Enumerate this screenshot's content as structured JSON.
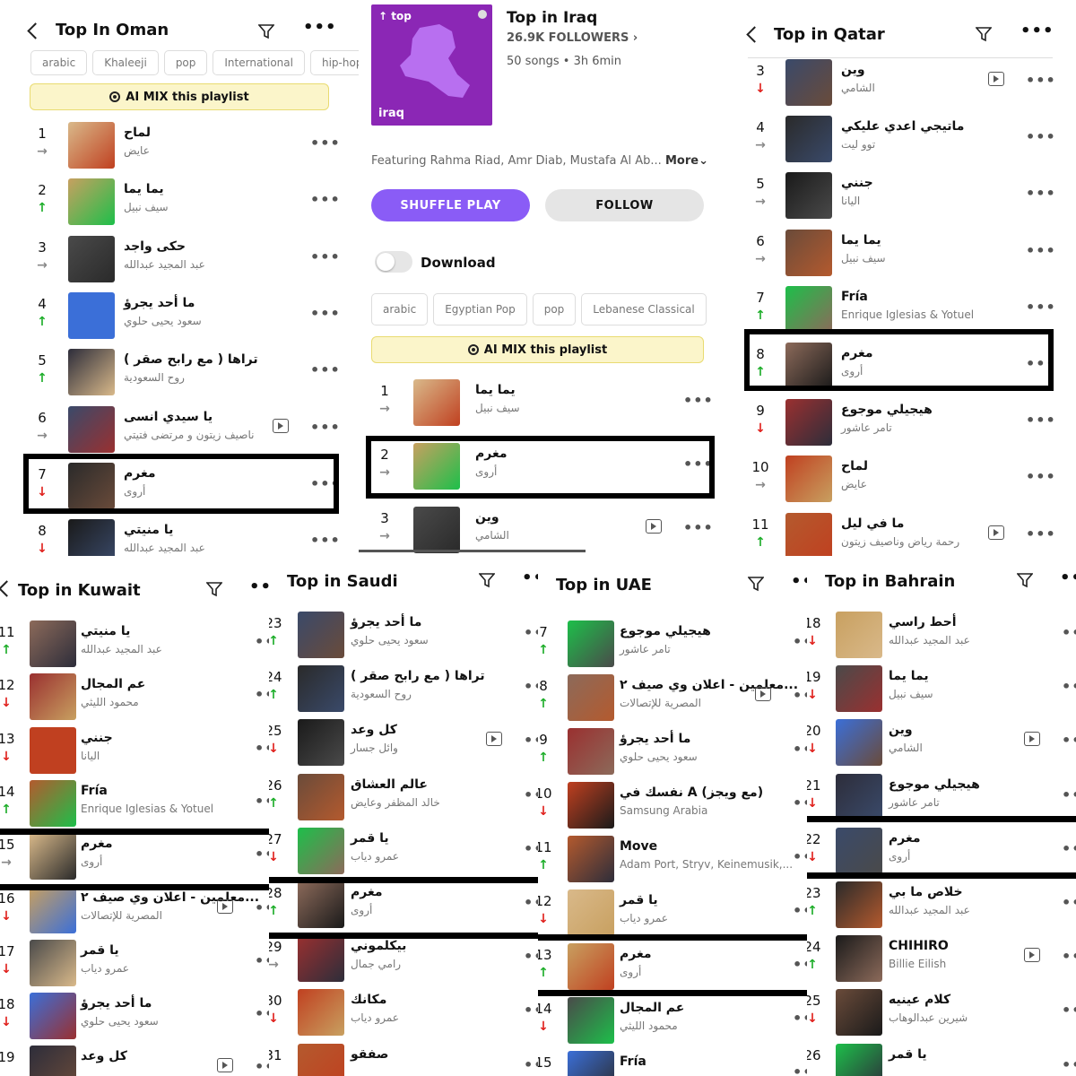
{
  "oman": {
    "title": "Top In Oman",
    "tags": [
      "arabic",
      "Khaleeji",
      "pop",
      "International",
      "hip-hop"
    ],
    "aimix": "AI MIX this playlist",
    "rows": [
      {
        "rank": "1",
        "arrow": "→",
        "t": "لماح",
        "a": "عايض"
      },
      {
        "rank": "2",
        "arrow": "↑",
        "t": "يما يما",
        "a": "سيف نبيل"
      },
      {
        "rank": "3",
        "arrow": "→",
        "t": "حكى واجد",
        "a": "عبد المجيد عبدالله"
      },
      {
        "rank": "4",
        "arrow": "↑",
        "t": "ما أحد يجرؤ",
        "a": "سعود يحيى حلوي"
      },
      {
        "rank": "5",
        "arrow": "↑",
        "t": "تراها ( مع رابح صقر )",
        "a": "روح السعودية"
      },
      {
        "rank": "6",
        "arrow": "→",
        "t": "يا سيدي انسى",
        "a": "ناصيف زيتون و مرتضى فتيتي"
      },
      {
        "rank": "7",
        "arrow": "↓",
        "t": "مغرم",
        "a": "أروى"
      },
      {
        "rank": "8",
        "arrow": "↓",
        "t": "يا منيتي",
        "a": "عبد المجيد عبدالله"
      }
    ]
  },
  "iraq": {
    "cover_brand": "top",
    "cover_label": "iraq",
    "title": "Top in Iraq",
    "followers": "26.9K FOLLOWERS",
    "meta": "50 songs • 3h 6min",
    "featuring": "Featuring Rahma Riad, Amr Diab, Mustafa Al Ab...",
    "more": "More",
    "shuffle": "SHUFFLE PLAY",
    "follow": "FOLLOW",
    "download": "Download",
    "tags": [
      "arabic",
      "Egyptian Pop",
      "pop",
      "Lebanese Classical"
    ],
    "aimix": "AI MIX this playlist",
    "rows": [
      {
        "rank": "1",
        "arrow": "→",
        "t": "يما يما",
        "a": "سيف نبيل"
      },
      {
        "rank": "2",
        "arrow": "→",
        "t": "مغرم",
        "a": "أروى"
      },
      {
        "rank": "3",
        "arrow": "→",
        "t": "وين",
        "a": "الشامي"
      }
    ]
  },
  "qatar": {
    "title": "Top in Qatar",
    "rows": [
      {
        "rank": "3",
        "arrow": "↓",
        "t": "وين",
        "a": "الشامي"
      },
      {
        "rank": "4",
        "arrow": "→",
        "t": "ماتيجي اعدي عليكي",
        "a": "توو ليت"
      },
      {
        "rank": "5",
        "arrow": "→",
        "t": "جنني",
        "a": "اليانا"
      },
      {
        "rank": "6",
        "arrow": "→",
        "t": "يما يما",
        "a": "سيف نبيل"
      },
      {
        "rank": "7",
        "arrow": "↑",
        "t": "Fría",
        "a": "Enrique Iglesias & Yotuel"
      },
      {
        "rank": "8",
        "arrow": "↑",
        "t": "مغرم",
        "a": "أروى"
      },
      {
        "rank": "9",
        "arrow": "↓",
        "t": "هيجيلي موجوع",
        "a": "تامر عاشور"
      },
      {
        "rank": "10",
        "arrow": "→",
        "t": "لماح",
        "a": "عايض"
      },
      {
        "rank": "11",
        "arrow": "↑",
        "t": "ما في ليل",
        "a": "رحمة رياض وناصيف زيتون"
      }
    ]
  },
  "kuwait": {
    "title": "Top in Kuwait",
    "rows": [
      {
        "rank": "11",
        "arrow": "↑",
        "t": "يا منيتي",
        "a": "عبد المجيد عبدالله"
      },
      {
        "rank": "12",
        "arrow": "↓",
        "t": "عم المجال",
        "a": "محمود الليثي"
      },
      {
        "rank": "13",
        "arrow": "↓",
        "t": "جنني",
        "a": "اليانا"
      },
      {
        "rank": "14",
        "arrow": "↑",
        "t": "Fría",
        "a": "Enrique Iglesias & Yotuel"
      },
      {
        "rank": "15",
        "arrow": "→",
        "t": "مغرم",
        "a": "أروى"
      },
      {
        "rank": "16",
        "arrow": "↓",
        "t": "معلمين - اعلان وي صيف ٢...",
        "a": "المصرية للإتصالات"
      },
      {
        "rank": "17",
        "arrow": "↓",
        "t": "يا قمر",
        "a": "عمرو دياب"
      },
      {
        "rank": "18",
        "arrow": "↓",
        "t": "ما أحد يجرؤ",
        "a": "سعود يحيى حلوي"
      },
      {
        "rank": "19",
        "arrow": "",
        "t": "كل وعد",
        "a": ""
      }
    ]
  },
  "saudi": {
    "title": "Top in Saudi",
    "rows": [
      {
        "rank": "23",
        "arrow": "↑",
        "t": "ما أحد يجرؤ",
        "a": "سعود يحيى حلوي"
      },
      {
        "rank": "24",
        "arrow": "↑",
        "t": "تراها ( مع رابح صقر )",
        "a": "روح السعودية"
      },
      {
        "rank": "25",
        "arrow": "↓",
        "t": "كل وعد",
        "a": "وائل جسار"
      },
      {
        "rank": "26",
        "arrow": "↑",
        "t": "عالم العشاق",
        "a": "خالد المظفر وعايض"
      },
      {
        "rank": "27",
        "arrow": "↓",
        "t": "يا قمر",
        "a": "عمرو دياب"
      },
      {
        "rank": "28",
        "arrow": "↑",
        "t": "مغرم",
        "a": "أروى"
      },
      {
        "rank": "29",
        "arrow": "→",
        "t": "بيكلموني",
        "a": "رامي جمال"
      },
      {
        "rank": "30",
        "arrow": "↓",
        "t": "مكانك",
        "a": "عمرو دياب"
      },
      {
        "rank": "31",
        "arrow": "",
        "t": "صفقو",
        "a": ""
      }
    ]
  },
  "uae": {
    "title": "Top in UAE",
    "rows": [
      {
        "rank": "7",
        "arrow": "↑",
        "t": "هيجيلي موجوع",
        "a": "تامر عاشور"
      },
      {
        "rank": "8",
        "arrow": "↑",
        "t": "معلمين - اعلان وي صيف ٢...",
        "a": "المصرية للإتصالات"
      },
      {
        "rank": "9",
        "arrow": "↑",
        "t": "ما أحد يجرؤ",
        "a": "سعود يحيى حلوي"
      },
      {
        "rank": "10",
        "arrow": "↓",
        "t": "نفسك في A (مع ويجز)",
        "a": "Samsung Arabia"
      },
      {
        "rank": "11",
        "arrow": "↑",
        "t": "Move",
        "a": "Adam Port, Stryv, Keinemusik,..."
      },
      {
        "rank": "12",
        "arrow": "↓",
        "t": "يا قمر",
        "a": "عمرو دياب"
      },
      {
        "rank": "13",
        "arrow": "↑",
        "t": "مغرم",
        "a": "أروى"
      },
      {
        "rank": "14",
        "arrow": "↓",
        "t": "عم المجال",
        "a": "محمود الليثي"
      },
      {
        "rank": "15",
        "arrow": "",
        "t": "Fría",
        "a": ""
      }
    ]
  },
  "bahrain": {
    "title": "Top in Bahrain",
    "rows": [
      {
        "rank": "18",
        "arrow": "↓",
        "t": "أحط راسي",
        "a": "عبد المجيد عبدالله"
      },
      {
        "rank": "19",
        "arrow": "↓",
        "t": "يما يما",
        "a": "سيف نبيل"
      },
      {
        "rank": "20",
        "arrow": "↓",
        "t": "وين",
        "a": "الشامي"
      },
      {
        "rank": "21",
        "arrow": "↓",
        "t": "هيجيلي موجوع",
        "a": "تامر عاشور"
      },
      {
        "rank": "22",
        "arrow": "↓",
        "t": "مغرم",
        "a": "أروى"
      },
      {
        "rank": "23",
        "arrow": "↑",
        "t": "خلاص ما بي",
        "a": "عبد المجيد عبدالله"
      },
      {
        "rank": "24",
        "arrow": "↑",
        "t": "CHIHIRO",
        "a": "Billie Eilish"
      },
      {
        "rank": "25",
        "arrow": "↓",
        "t": "كلام عينيه",
        "a": "شيرين عبدالوهاب"
      },
      {
        "rank": "26",
        "arrow": "",
        "t": "يا قمر",
        "a": ""
      }
    ]
  }
}
